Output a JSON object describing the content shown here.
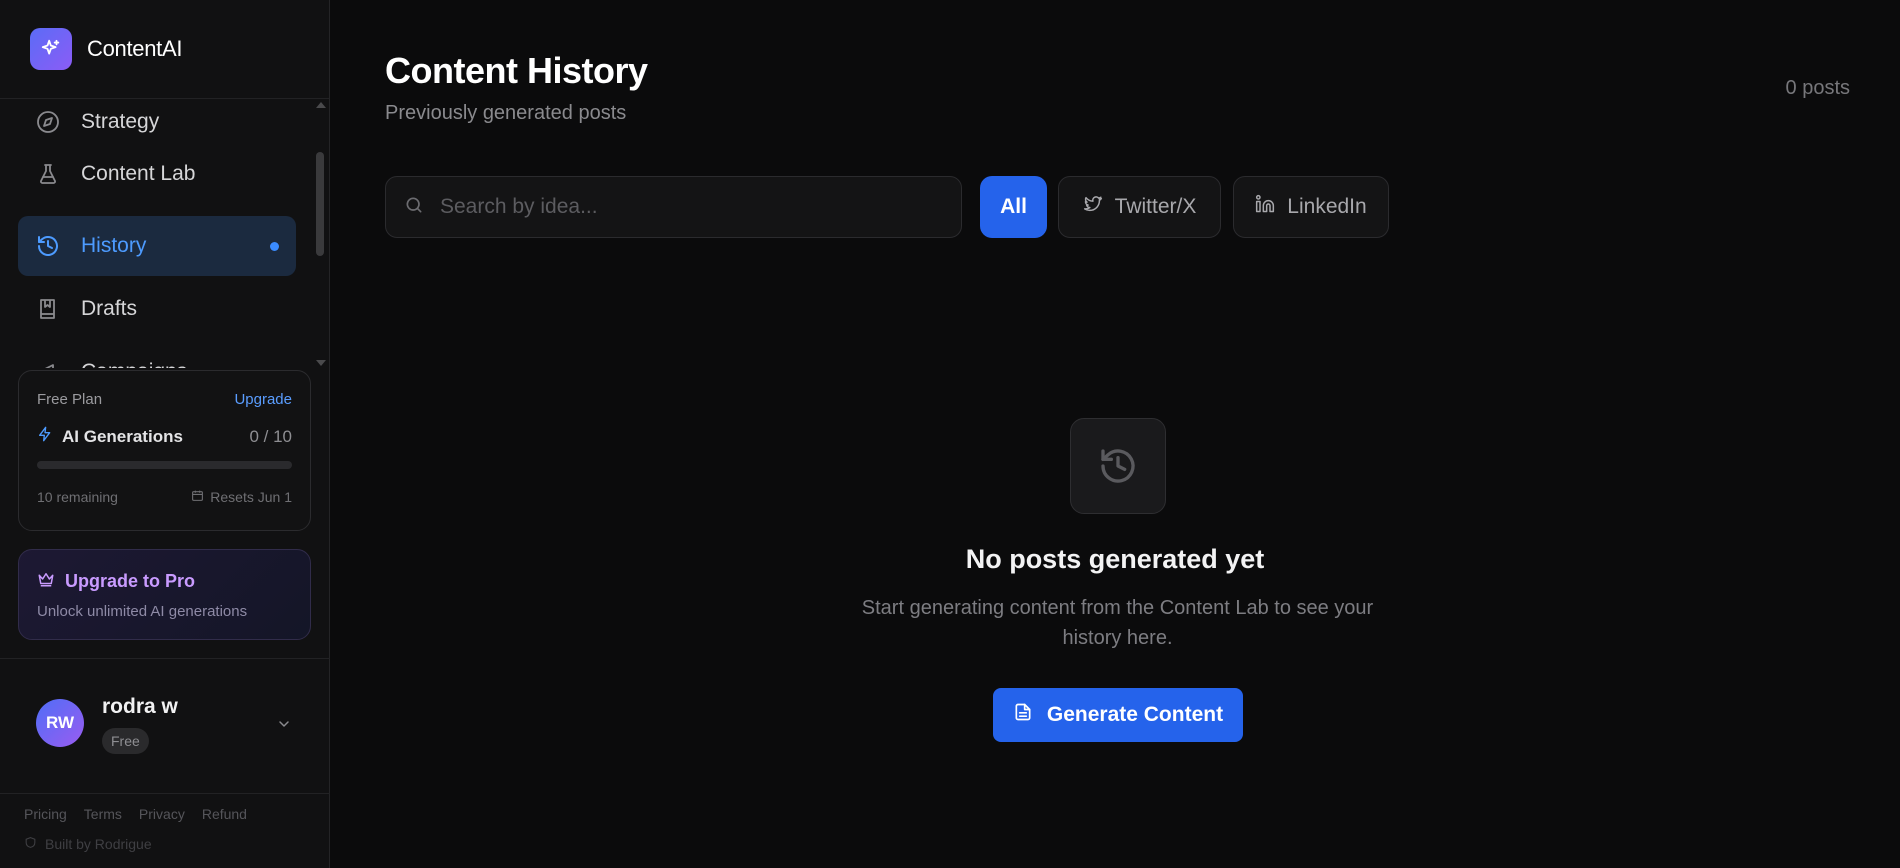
{
  "brand": {
    "name": "ContentAI"
  },
  "sidebar": {
    "items": [
      {
        "label": "Strategy",
        "icon": "compass-icon",
        "active": false
      },
      {
        "label": "Content Lab",
        "icon": "flask-icon",
        "active": false
      },
      {
        "label": "History",
        "icon": "history-icon",
        "active": true
      },
      {
        "label": "Drafts",
        "icon": "book-icon",
        "active": false
      },
      {
        "label": "Campaigns",
        "icon": "megaphone-icon",
        "active": false
      }
    ]
  },
  "plan": {
    "name": "Free Plan",
    "upgrade_label": "Upgrade",
    "generations_label": "AI Generations",
    "generations_count": "0 / 10",
    "usage_fraction": 0,
    "remaining": "10 remaining",
    "resets": "Resets Jun 1"
  },
  "pro": {
    "title": "Upgrade to Pro",
    "subtitle": "Unlock unlimited AI generations"
  },
  "user": {
    "initials": "RW",
    "name": "rodra w",
    "badge": "Free"
  },
  "footer": {
    "links": [
      "Pricing",
      "Terms",
      "Privacy",
      "Refund"
    ],
    "built_by": "Built by Rodrigue"
  },
  "main": {
    "title": "Content History",
    "subtitle": "Previously generated posts",
    "post_count": "0 posts",
    "search_placeholder": "Search by idea...",
    "filters": [
      "All",
      "Twitter/X",
      "LinkedIn"
    ],
    "empty_title": "No posts generated yet",
    "empty_subtitle": "Start generating content from the Content Lab to see your history here.",
    "generate_label": "Generate Content"
  },
  "colors": {
    "accent": "#2563eb",
    "active_nav": "#4d9bff",
    "pro": "#c99bff"
  }
}
